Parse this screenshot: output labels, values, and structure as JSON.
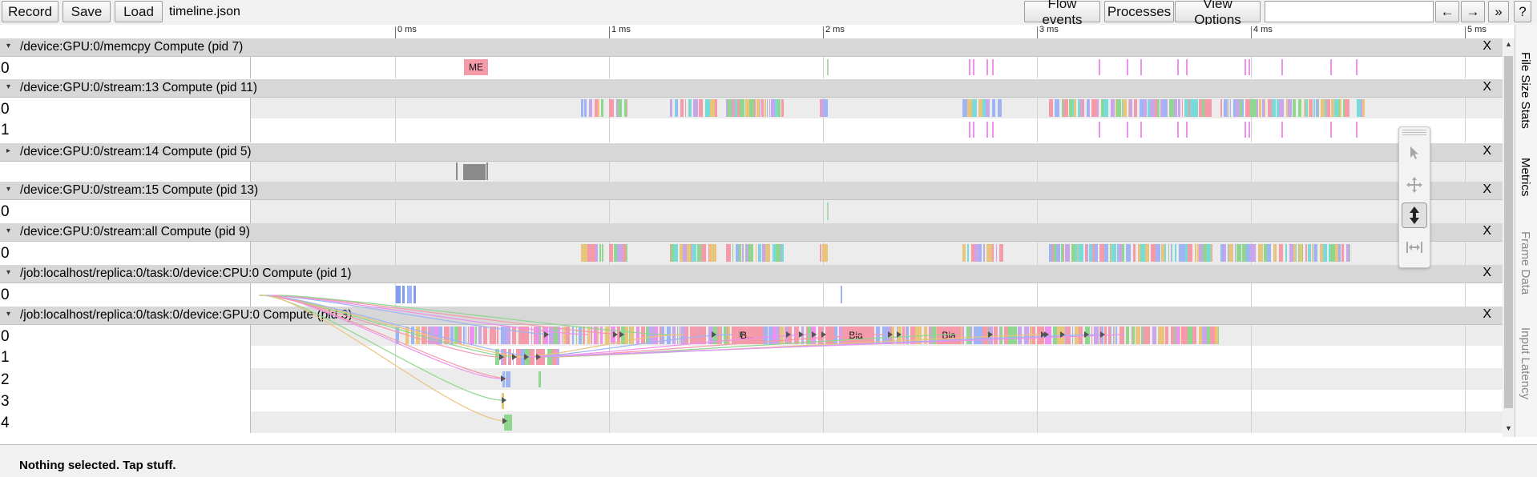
{
  "toolbar": {
    "record_label": "Record",
    "save_label": "Save",
    "load_label": "Load",
    "filename": "timeline.json",
    "flow_events_label": "Flow events",
    "processes_label": "Processes",
    "view_options_label": "View Options",
    "search_value": "",
    "prev_label": "←",
    "next_label": "→",
    "more_label": "»",
    "help_label": "?"
  },
  "ruler": {
    "labels": [
      "0 ms",
      "1 ms",
      "2 ms",
      "3 ms",
      "4 ms",
      "5 ms"
    ]
  },
  "processes": [
    {
      "title": "/device:GPU:0/memcpy Compute (pid 7)",
      "threads": [
        "0"
      ],
      "close": "X"
    },
    {
      "title": "/device:GPU:0/stream:13 Compute (pid 11)",
      "threads": [
        "0",
        "1"
      ],
      "close": "X"
    },
    {
      "title": "/device:GPU:0/stream:14 Compute (pid 5)",
      "threads": [],
      "close": "X"
    },
    {
      "title": "/device:GPU:0/stream:15 Compute (pid 13)",
      "threads": [
        "0"
      ],
      "close": "X"
    },
    {
      "title": "/device:GPU:0/stream:all Compute (pid 9)",
      "threads": [
        "0"
      ],
      "close": "X"
    },
    {
      "title": "/job:localhost/replica:0/task:0/device:CPU:0 Compute (pid 1)",
      "threads": [
        "0"
      ],
      "close": "X"
    },
    {
      "title": "/job:localhost/replica:0/task:0/device:GPU:0 Compute (pid 3)",
      "threads": [
        "0",
        "1",
        "2",
        "3",
        "4"
      ],
      "close": "X"
    }
  ],
  "slice_labels": {
    "memcpy": "ME",
    "gpu_b1": "B...",
    "gpu_b2": "Bia",
    "gpu_b3": "Bia"
  },
  "side_tabs": [
    "File Size Stats",
    "Metrics",
    "Frame Data",
    "Input Latency"
  ],
  "mouse_modes": [
    "selection-mode",
    "pan-mode",
    "zoom-mode",
    "timing-mode"
  ],
  "status": "Nothing selected. Tap stuff.",
  "colors": {
    "pink": "#f59aa9",
    "green": "#8fd68f",
    "purple": "#c8a6e9",
    "blue": "#9fb4f5",
    "yellow": "#e9c47d",
    "magenta": "#ee91ee",
    "teal": "#79dbd9",
    "gray": "#8a8a8a"
  }
}
